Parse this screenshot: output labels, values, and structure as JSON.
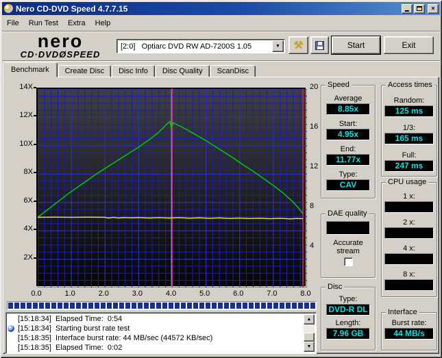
{
  "window": {
    "title": "Nero CD-DVD Speed 4.7.7.15"
  },
  "menu": {
    "items": [
      "File",
      "Run Test",
      "Extra",
      "Help"
    ]
  },
  "toolbar": {
    "logo_line1": "nero",
    "logo_line2": "CD·DVDØSPEED",
    "drive_selector_value": "[2:0]   Optiarc DVD RW AD-7200S 1.05",
    "start_label": "Start",
    "exit_label": "Exit"
  },
  "tabs": {
    "items": [
      "Benchmark",
      "Create Disc",
      "Disc Info",
      "Disc Quality",
      "ScanDisc"
    ],
    "active": "Benchmark"
  },
  "chart_data": {
    "type": "line",
    "x_range": [
      0,
      8
    ],
    "y_left_range": [
      0,
      14
    ],
    "y_right_range": [
      0,
      20
    ],
    "x_ticks": [
      "0.0",
      "1.0",
      "2.0",
      "3.0",
      "4.0",
      "5.0",
      "6.0",
      "7.0",
      "8.0"
    ],
    "y_left_ticks": [
      "14X",
      "12X",
      "10X",
      "8X",
      "6X",
      "4X",
      "2X"
    ],
    "y_right_ticks": [
      "20",
      "16",
      "12",
      "8",
      "4"
    ],
    "grid": {
      "x_minor": 0.2,
      "x_major": 1.0,
      "y_minor": 0.5,
      "y_major": 2.0,
      "on": true
    },
    "series": [
      {
        "name": "read-speed",
        "color": "#00cc00",
        "points": [
          [
            0,
            4.95
          ],
          [
            0.3,
            5.5
          ],
          [
            0.6,
            6.05
          ],
          [
            0.9,
            6.6
          ],
          [
            1.2,
            7.1
          ],
          [
            1.5,
            7.6
          ],
          [
            1.8,
            8.1
          ],
          [
            2.1,
            8.55
          ],
          [
            2.4,
            9.0
          ],
          [
            2.7,
            9.45
          ],
          [
            3.0,
            9.9
          ],
          [
            3.3,
            10.4
          ],
          [
            3.6,
            10.95
          ],
          [
            3.85,
            11.55
          ],
          [
            3.93,
            11.7
          ],
          [
            3.97,
            11.25
          ],
          [
            4.02,
            11.62
          ],
          [
            4.3,
            11.3
          ],
          [
            4.6,
            10.9
          ],
          [
            4.9,
            10.5
          ],
          [
            5.2,
            10.05
          ],
          [
            5.5,
            9.6
          ],
          [
            5.8,
            9.15
          ],
          [
            6.1,
            8.65
          ],
          [
            6.4,
            8.2
          ],
          [
            6.7,
            7.7
          ],
          [
            7.0,
            7.2
          ],
          [
            7.3,
            6.65
          ],
          [
            7.6,
            6.0
          ],
          [
            7.75,
            5.6
          ],
          [
            7.88,
            5.2
          ]
        ]
      },
      {
        "name": "rotation-speed",
        "color": "#e6e600",
        "points": [
          [
            0,
            4.95
          ],
          [
            0.5,
            4.96
          ],
          [
            1.0,
            4.95
          ],
          [
            1.5,
            4.96
          ],
          [
            2.0,
            4.95
          ],
          [
            2.1,
            4.9
          ],
          [
            2.25,
            4.95
          ],
          [
            2.4,
            4.9
          ],
          [
            2.55,
            4.94
          ],
          [
            2.8,
            4.91
          ],
          [
            3.0,
            4.94
          ],
          [
            3.3,
            4.9
          ],
          [
            3.6,
            4.93
          ],
          [
            3.9,
            4.9
          ],
          [
            4.2,
            4.93
          ],
          [
            4.5,
            4.89
          ],
          [
            4.8,
            4.92
          ],
          [
            5.1,
            4.88
          ],
          [
            5.4,
            4.91
          ],
          [
            5.7,
            4.87
          ],
          [
            6.0,
            4.9
          ],
          [
            6.3,
            4.86
          ],
          [
            6.6,
            4.89
          ],
          [
            6.9,
            4.85
          ],
          [
            7.2,
            4.88
          ],
          [
            7.5,
            4.84
          ],
          [
            7.7,
            4.87
          ],
          [
            7.88,
            4.85
          ]
        ]
      }
    ],
    "markers": [
      {
        "name": "layer-transition-marker",
        "x": 3.98,
        "color": "#d24fd2"
      },
      {
        "name": "test-end-marker",
        "x": 7.88,
        "color": "#cc2020"
      }
    ],
    "title": "",
    "xlabel": "",
    "ylabel": ""
  },
  "progress": {
    "fraction": 1.0
  },
  "panels": {
    "speed": {
      "title": "Speed",
      "fields": [
        {
          "label": "Average",
          "value": "8.85x"
        },
        {
          "label": "Start:",
          "value": "4.95x"
        },
        {
          "label": "End:",
          "value": "11.77x"
        },
        {
          "label": "Type:",
          "value": "CAV"
        }
      ]
    },
    "access_times": {
      "title": "Access times",
      "fields": [
        {
          "label": "Random:",
          "value": "125 ms"
        },
        {
          "label": "1/3:",
          "value": "165 ms"
        },
        {
          "label": "Full:",
          "value": "247 ms"
        }
      ]
    },
    "cpu_usage": {
      "title": "CPU usage",
      "fields": [
        {
          "label": "1 x:",
          "value": ""
        },
        {
          "label": "2 x:",
          "value": ""
        },
        {
          "label": "4 x:",
          "value": ""
        },
        {
          "label": "8 x:",
          "value": ""
        }
      ]
    },
    "dae_quality": {
      "title": "DAE quality",
      "box_value": "",
      "checkbox_label_1": "Accurate",
      "checkbox_label_2": "stream",
      "checked": false
    },
    "disc": {
      "title": "Disc",
      "fields": [
        {
          "label": "Type:",
          "value": "DVD-R DL"
        },
        {
          "label": "Length:",
          "value": "7.96 GB"
        }
      ]
    },
    "interface": {
      "title": "Interface",
      "fields": [
        {
          "label": "Burst rate:",
          "value": "44 MB/s"
        }
      ]
    }
  },
  "log": {
    "entries": [
      {
        "time": "[15:18:34]",
        "text": "Elapsed Time:  0:54",
        "icon": false
      },
      {
        "time": "[15:18:34]",
        "text": "Starting burst rate test",
        "icon": true
      },
      {
        "time": "[15:18:35]",
        "text": "Interface burst rate: 44 MB/sec (44572 KB/sec)",
        "icon": false
      },
      {
        "time": "[15:18:35]",
        "text": "Elapsed Time:  0:02",
        "icon": false
      }
    ]
  },
  "colors": {
    "value_text": "#00e6e6",
    "value_bg": "#000000",
    "grid_minor": "#1d1db2",
    "grid_major": "#2e2ed6",
    "titlebar_left": "#0b2d88",
    "titlebar_right": "#5591d2",
    "window_face": "#d4d0c8"
  }
}
